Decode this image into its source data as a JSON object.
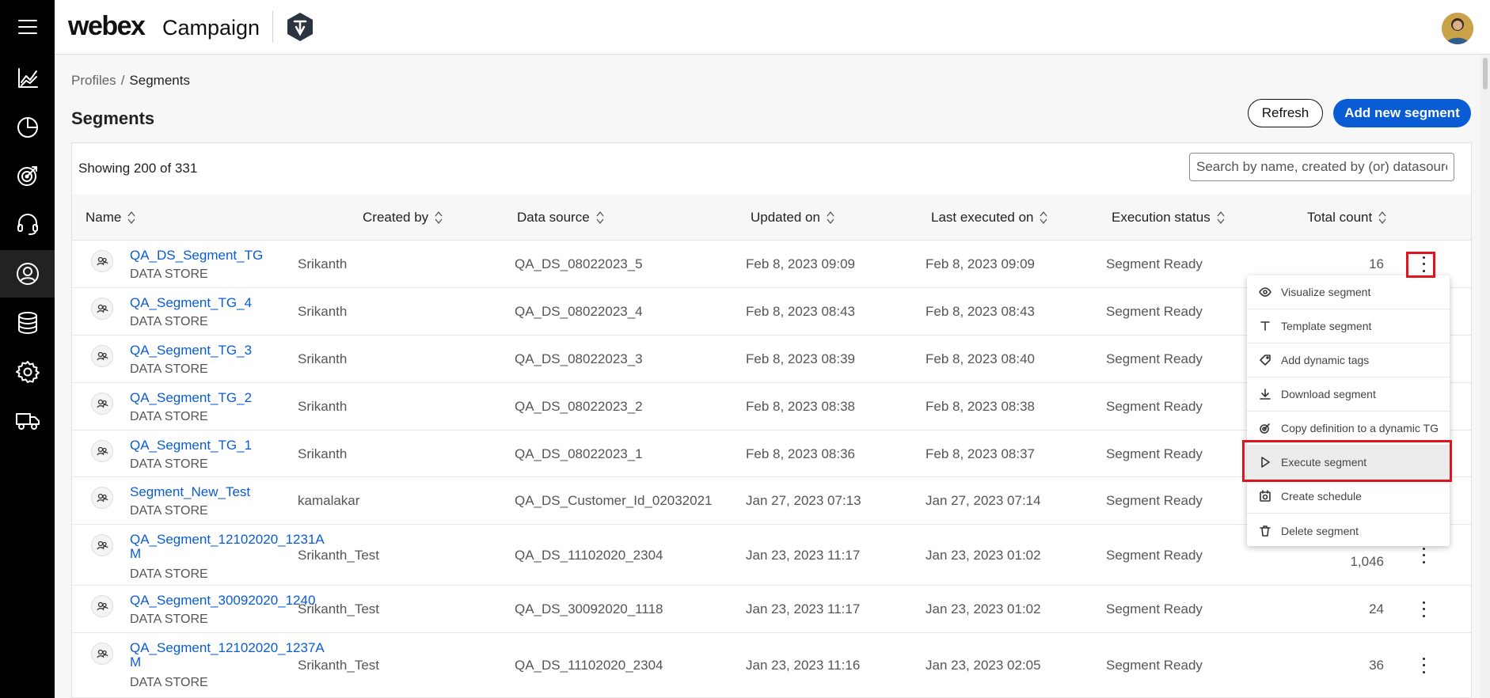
{
  "header": {
    "brand": "webex",
    "product": "Campaign"
  },
  "nav": [
    "menu-icon",
    "analytics-icon",
    "reports-icon",
    "campaigns-icon",
    "support-icon",
    "profiles-icon",
    "datastore-icon",
    "settings-icon",
    "delivery-icon"
  ],
  "breadcrumb": {
    "parent": "Profiles",
    "separator": "/",
    "current": "Segments"
  },
  "page": {
    "title": "Segments",
    "refresh_label": "Refresh",
    "add_label": "Add new segment"
  },
  "table": {
    "showing": "Showing 200 of 331",
    "search_placeholder": "Search by name, created by (or) datasource",
    "columns": [
      "Name",
      "Created by",
      "Data source",
      "Updated on",
      "Last executed on",
      "Execution status",
      "Total count"
    ],
    "rows": [
      {
        "name": "QA_DS_Segment_TG",
        "type": "DATA STORE",
        "created_by": "Srikanth",
        "data_source": "QA_DS_08022023_5",
        "updated_on": "Feb 8, 2023 09:09",
        "last_executed": "Feb 8, 2023 09:09",
        "status": "Segment Ready",
        "count": "16"
      },
      {
        "name": "QA_Segment_TG_4",
        "type": "DATA STORE",
        "created_by": "Srikanth",
        "data_source": "QA_DS_08022023_4",
        "updated_on": "Feb 8, 2023 08:43",
        "last_executed": "Feb 8, 2023 08:43",
        "status": "Segment Ready",
        "count": ""
      },
      {
        "name": "QA_Segment_TG_3",
        "type": "DATA STORE",
        "created_by": "Srikanth",
        "data_source": "QA_DS_08022023_3",
        "updated_on": "Feb 8, 2023 08:39",
        "last_executed": "Feb 8, 2023 08:40",
        "status": "Segment Ready",
        "count": ""
      },
      {
        "name": "QA_Segment_TG_2",
        "type": "DATA STORE",
        "created_by": "Srikanth",
        "data_source": "QA_DS_08022023_2",
        "updated_on": "Feb 8, 2023 08:38",
        "last_executed": "Feb 8, 2023 08:38",
        "status": "Segment Ready",
        "count": ""
      },
      {
        "name": "QA_Segment_TG_1",
        "type": "DATA STORE",
        "created_by": "Srikanth",
        "data_source": "QA_DS_08022023_1",
        "updated_on": "Feb 8, 2023 08:36",
        "last_executed": "Feb 8, 2023 08:37",
        "status": "Segment Ready",
        "count": ""
      },
      {
        "name": "Segment_New_Test",
        "type": "DATA STORE",
        "created_by": "kamalakar",
        "data_source": "QA_DS_Customer_Id_02032021",
        "updated_on": "Jan 27, 2023 07:13",
        "last_executed": "Jan 27, 2023 07:14",
        "status": "Segment Ready",
        "count": ""
      },
      {
        "name": "QA_Segment_12102020_1231AM",
        "type": "DATA STORE",
        "created_by": "Srikanth_Test",
        "data_source": "QA_DS_11102020_2304",
        "updated_on": "Jan 23, 2023 11:17",
        "last_executed": "Jan 23, 2023 01:02",
        "status": "Segment Ready",
        "count": "1,046"
      },
      {
        "name": "QA_Segment_30092020_1240",
        "type": "DATA STORE",
        "created_by": "Srikanth_Test",
        "data_source": "QA_DS_30092020_1118",
        "updated_on": "Jan 23, 2023 11:17",
        "last_executed": "Jan 23, 2023 01:02",
        "status": "Segment Ready",
        "count": "24"
      },
      {
        "name": "QA_Segment_12102020_1237AM",
        "type": "DATA STORE",
        "created_by": "Srikanth_Test",
        "data_source": "QA_DS_11102020_2304",
        "updated_on": "Jan 23, 2023 11:16",
        "last_executed": "Jan 23, 2023 02:05",
        "status": "Segment Ready",
        "count": "36"
      }
    ]
  },
  "context_menu": {
    "items": [
      {
        "label": "Visualize segment",
        "icon": "eye-icon"
      },
      {
        "label": "Template segment",
        "icon": "text-icon"
      },
      {
        "label": "Add dynamic tags",
        "icon": "tag-icon"
      },
      {
        "label": "Download segment",
        "icon": "download-icon"
      },
      {
        "label": "Copy definition to a dynamic TG",
        "icon": "target-icon"
      },
      {
        "label": "Execute segment",
        "icon": "play-icon"
      },
      {
        "label": "Create schedule",
        "icon": "schedule-icon"
      },
      {
        "label": "Delete segment",
        "icon": "trash-icon"
      }
    ]
  },
  "colors": {
    "accent": "#0a5cd5",
    "highlight": "#e0141c",
    "rail": "#000000"
  }
}
